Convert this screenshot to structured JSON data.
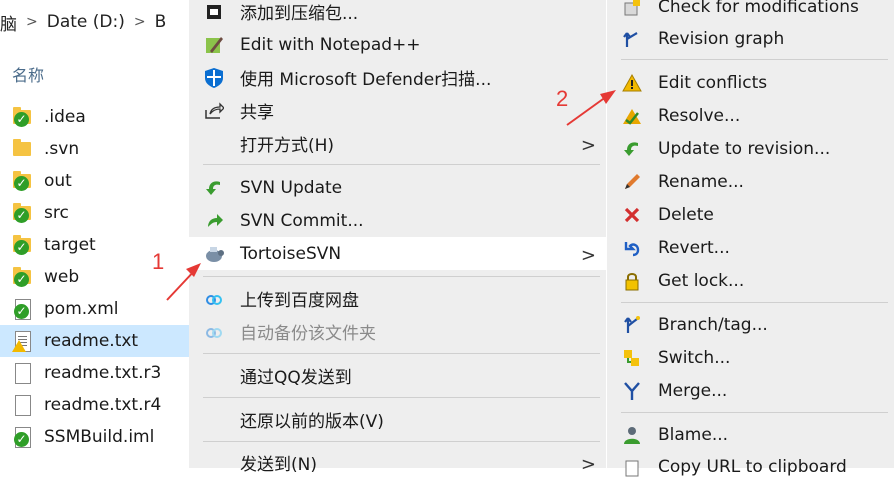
{
  "breadcrumb": {
    "prev": "脑",
    "drive": "Date (D:)",
    "next": "B"
  },
  "explorer": {
    "column_header": "名称",
    "files": [
      {
        "name": ".idea",
        "icon": "folder-svn-check-icon"
      },
      {
        "name": ".svn",
        "icon": "folder-icon"
      },
      {
        "name": "out",
        "icon": "folder-svn-check-icon"
      },
      {
        "name": "src",
        "icon": "folder-svn-check-icon"
      },
      {
        "name": "target",
        "icon": "folder-svn-check-icon"
      },
      {
        "name": "web",
        "icon": "folder-svn-check-icon"
      },
      {
        "name": "pom.xml",
        "icon": "file-svn-check-icon"
      },
      {
        "name": "readme.txt",
        "icon": "file-svn-conflict-icon",
        "selected": true
      },
      {
        "name": "readme.txt.r3",
        "icon": "file-icon"
      },
      {
        "name": "readme.txt.r4",
        "icon": "file-icon"
      },
      {
        "name": "SSMBuild.iml",
        "icon": "file-svn-check-icon"
      }
    ]
  },
  "menu1": {
    "items": [
      {
        "label": "添加到压缩包...",
        "icon": "archive-icon"
      },
      {
        "label": "Edit with Notepad++",
        "icon": "notepadpp-icon"
      },
      {
        "label": "使用 Microsoft Defender扫描...",
        "icon": "defender-shield-icon"
      },
      {
        "label": "共享",
        "icon": "share-icon"
      },
      {
        "label": "打开方式(H)",
        "icon": ""
      },
      {
        "label": "SVN Update",
        "icon": "svn-update-icon"
      },
      {
        "label": "SVN Commit...",
        "icon": "svn-commit-icon"
      },
      {
        "label": "TortoiseSVN",
        "icon": "tortoise-icon"
      },
      {
        "label": "上传到百度网盘",
        "icon": "baidu-cloud-icon"
      },
      {
        "label": "自动备份该文件夹",
        "icon": "baidu-cloud-icon"
      },
      {
        "label": "通过QQ发送到",
        "icon": ""
      },
      {
        "label": "还原以前的版本(V)",
        "icon": ""
      },
      {
        "label": "发送到(N)",
        "icon": ""
      }
    ]
  },
  "menu2": {
    "items": [
      {
        "label": "Check for modifications",
        "icon": "check-modifications-icon"
      },
      {
        "label": "Revision graph",
        "icon": "revision-graph-icon"
      },
      {
        "label": "Edit conflicts",
        "icon": "conflict-warning-icon"
      },
      {
        "label": "Resolve...",
        "icon": "resolve-icon"
      },
      {
        "label": "Update to revision...",
        "icon": "update-revision-icon"
      },
      {
        "label": "Rename...",
        "icon": "rename-pencil-icon"
      },
      {
        "label": "Delete",
        "icon": "delete-x-icon"
      },
      {
        "label": "Revert...",
        "icon": "revert-icon"
      },
      {
        "label": "Get lock...",
        "icon": "lock-icon"
      },
      {
        "label": "Branch/tag...",
        "icon": "branch-icon"
      },
      {
        "label": "Switch...",
        "icon": "switch-icon"
      },
      {
        "label": "Merge...",
        "icon": "merge-icon"
      },
      {
        "label": "Blame...",
        "icon": "blame-icon"
      },
      {
        "label": "Copy URL to clipboard",
        "icon": "copy-url-icon"
      }
    ]
  },
  "annotations": {
    "one": "1",
    "two": "2"
  },
  "colors": {
    "menu_bg": "#eeeeee",
    "selection": "#cce8ff",
    "annotation": "#e53935",
    "svn_green": "#2f9e28"
  }
}
